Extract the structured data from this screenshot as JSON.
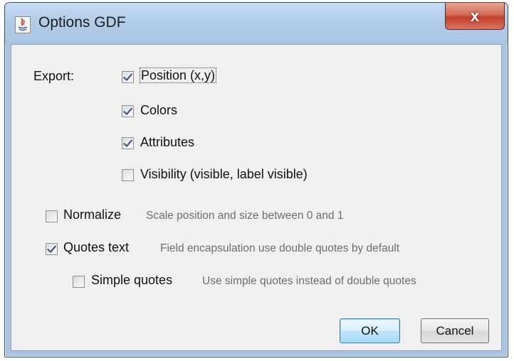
{
  "window": {
    "title": "Options GDF",
    "close_label": "x"
  },
  "export": {
    "label": "Export:",
    "options": [
      {
        "label": "Position (x,y)",
        "checked": true
      },
      {
        "label": "Colors",
        "checked": true
      },
      {
        "label": "Attributes",
        "checked": true
      },
      {
        "label": "Visibility (visible, label visible)",
        "checked": false
      }
    ]
  },
  "normalize": {
    "label": "Normalize",
    "description": "Scale position and size between 0 and 1",
    "checked": false
  },
  "quotes_text": {
    "label": "Quotes text",
    "description": "Field encapsulation use double quotes by default",
    "checked": true
  },
  "simple_quotes": {
    "label": "Simple quotes",
    "description": "Use simple quotes instead of double quotes",
    "checked": false
  },
  "buttons": {
    "ok": "OK",
    "cancel": "Cancel"
  },
  "colors": {
    "title_bar": "#b2cde8",
    "close_button": "#c2412b",
    "dialog_bg": "#f0f0f0",
    "check_mark": "#324d8f"
  }
}
